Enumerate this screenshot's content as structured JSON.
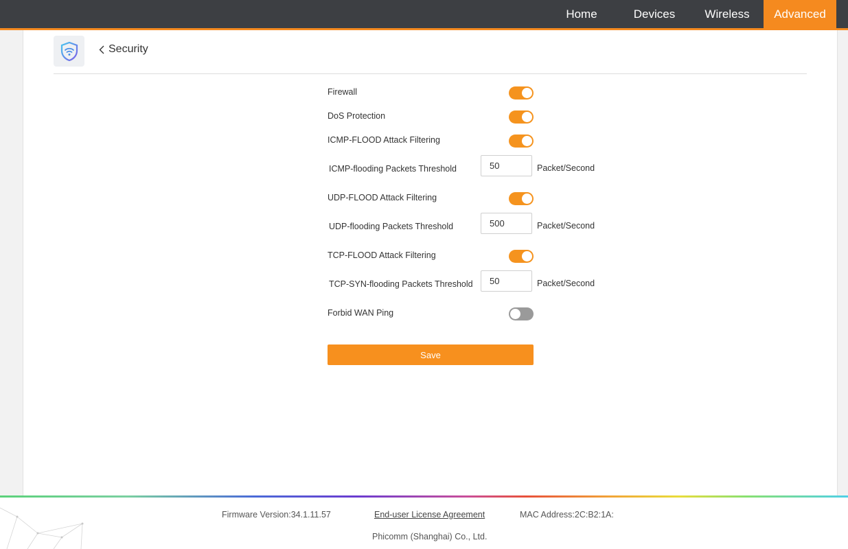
{
  "nav": {
    "items": [
      {
        "label": "Home",
        "active": false
      },
      {
        "label": "Devices",
        "active": false
      },
      {
        "label": "Wireless",
        "active": false
      },
      {
        "label": "Advanced",
        "active": true
      }
    ]
  },
  "page": {
    "title": "Security",
    "icon": "shield-wifi-icon"
  },
  "form": {
    "firewall": {
      "label": "Firewall",
      "on": true
    },
    "dos": {
      "label": "DoS Protection",
      "on": true
    },
    "icmp_filter": {
      "label": "ICMP-FLOOD Attack Filtering",
      "on": true
    },
    "icmp_threshold": {
      "label": "ICMP-flooding Packets Threshold",
      "value": "50",
      "unit": "Packet/Second"
    },
    "udp_filter": {
      "label": "UDP-FLOOD Attack Filtering",
      "on": true
    },
    "udp_threshold": {
      "label": "UDP-flooding Packets Threshold",
      "value": "500",
      "unit": "Packet/Second"
    },
    "tcp_filter": {
      "label": "TCP-FLOOD Attack Filtering",
      "on": true
    },
    "tcp_threshold": {
      "label": "TCP-SYN-flooding Packets Threshold",
      "value": "50",
      "unit": "Packet/Second"
    },
    "wan_ping": {
      "label": "Forbid WAN Ping",
      "on": false
    },
    "save_label": "Save"
  },
  "footer": {
    "firmware": "Firmware Version:34.1.11.57",
    "license": "End-user License Agreement",
    "mac": "MAC Address:2C:B2:1A:",
    "company": "Phicomm (Shanghai) Co., Ltd."
  },
  "colors": {
    "accent": "#f58a1f",
    "topbar": "#3d3f43",
    "toggle_off": "#9a9a9a"
  }
}
